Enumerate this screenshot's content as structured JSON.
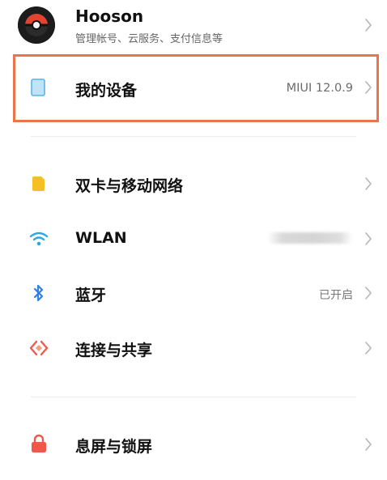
{
  "account": {
    "name": "Hooson",
    "subtitle": "管理帐号、云服务、支付信息等",
    "avatar_icon": "pokeball-avatar-icon"
  },
  "device_row": {
    "label": "我的设备",
    "value": "MIUI 12.0.9",
    "icon": "tablet-icon",
    "highlight_color": "#e8764a"
  },
  "settings": [
    {
      "key": "sim",
      "label": "双卡与移动网络",
      "value": "",
      "icon": "sim-card-icon",
      "icon_color": "#f5c023"
    },
    {
      "key": "wlan",
      "label": "WLAN",
      "value": "",
      "icon": "wifi-icon",
      "icon_color": "#2aa8e6"
    },
    {
      "key": "bluetooth",
      "label": "蓝牙",
      "value": "已开启",
      "icon": "bluetooth-icon",
      "icon_color": "#2f80e8"
    },
    {
      "key": "share",
      "label": "连接与共享",
      "value": "",
      "icon": "connection-share-icon",
      "icon_color": "#ef5b4e"
    }
  ],
  "lock_row": {
    "label": "息屏与锁屏",
    "icon": "lock-icon",
    "icon_color": "#f0574a"
  }
}
